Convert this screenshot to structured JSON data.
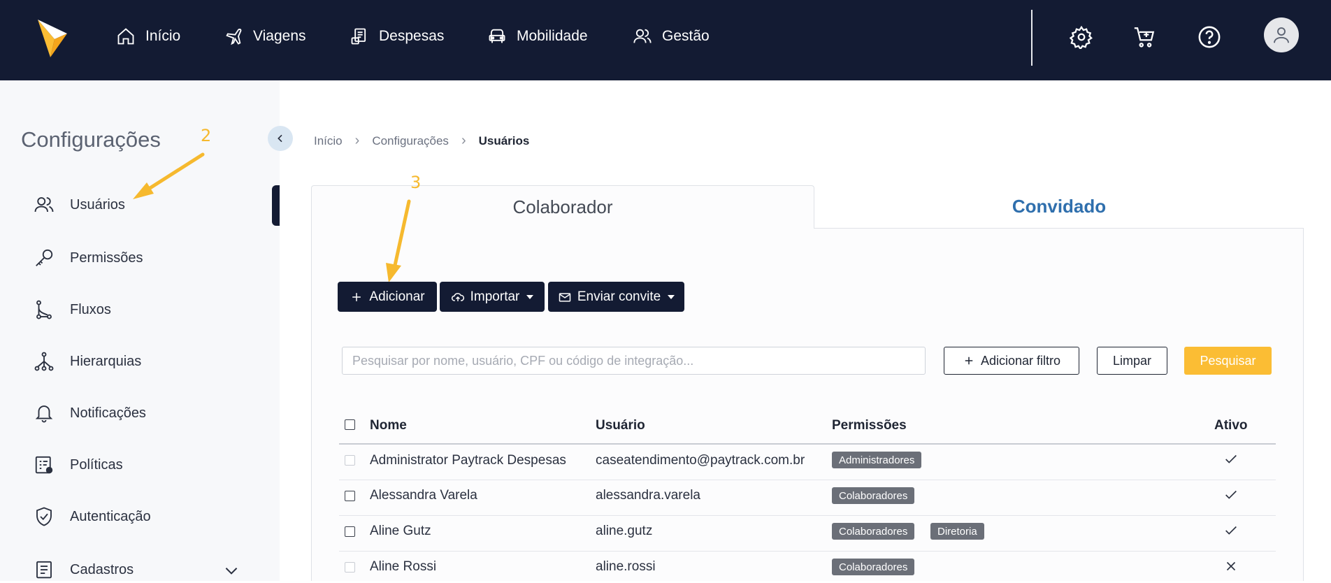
{
  "nav": {
    "items": [
      {
        "label": "Início",
        "icon": "home-icon"
      },
      {
        "label": "Viagens",
        "icon": "plane-icon"
      },
      {
        "label": "Despesas",
        "icon": "receipt-icon"
      },
      {
        "label": "Mobilidade",
        "icon": "car-icon"
      },
      {
        "label": "Gestão",
        "icon": "users-icon"
      }
    ],
    "right_icons": [
      "gear-icon",
      "cart-icon",
      "help-icon",
      "user-avatar-icon"
    ]
  },
  "sidebar": {
    "title": "Configurações",
    "items": [
      {
        "label": "Usuários",
        "icon": "users-icon"
      },
      {
        "label": "Permissões",
        "icon": "key-icon"
      },
      {
        "label": "Fluxos",
        "icon": "flow-icon"
      },
      {
        "label": "Hierarquias",
        "icon": "hierarchy-icon"
      },
      {
        "label": "Notificações",
        "icon": "bell-icon"
      },
      {
        "label": "Políticas",
        "icon": "policy-icon"
      },
      {
        "label": "Autenticação",
        "icon": "shield-icon"
      },
      {
        "label": "Cadastros",
        "icon": "register-icon"
      }
    ]
  },
  "annotations": {
    "sidebar_number": "2",
    "add_number": "3"
  },
  "breadcrumb": {
    "items": [
      "Início",
      "Configurações"
    ],
    "current": "Usuários"
  },
  "tabs": {
    "active": "Colaborador",
    "inactive": "Convidado"
  },
  "actions": {
    "add": "Adicionar",
    "import": "Importar",
    "invite": "Enviar convite"
  },
  "search": {
    "placeholder": "Pesquisar por nome, usuário, CPF ou código de integração...",
    "add_filter": "Adicionar filtro",
    "clear": "Limpar",
    "submit": "Pesquisar"
  },
  "table": {
    "headers": {
      "name": "Nome",
      "user": "Usuário",
      "permissions": "Permissões",
      "active": "Ativo"
    },
    "rows": [
      {
        "name": "Administrator Paytrack Despesas",
        "user": "caseatendimento@paytrack.com.br",
        "permissions": [
          "Administradores"
        ],
        "active": true
      },
      {
        "name": "Alessandra Varela",
        "user": "alessandra.varela",
        "permissions": [
          "Colaboradores"
        ],
        "active": true
      },
      {
        "name": "Aline Gutz",
        "user": "aline.gutz",
        "permissions": [
          "Colaboradores",
          "Diretoria"
        ],
        "active": true
      },
      {
        "name": "Aline Rossi",
        "user": "aline.rossi",
        "permissions": [
          "Colaboradores"
        ],
        "active": false
      }
    ]
  },
  "colors": {
    "navy": "#131b33",
    "accent_yellow": "#fbbd34",
    "link_blue": "#2f6fad"
  }
}
